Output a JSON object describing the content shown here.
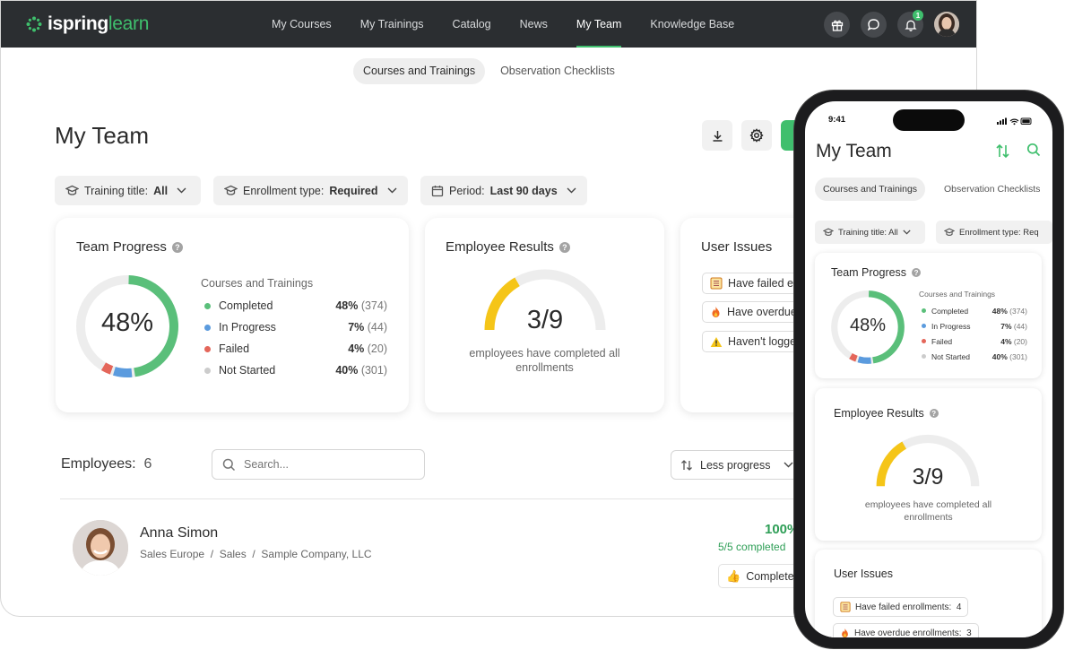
{
  "app": {
    "logo_brand": "ispring",
    "logo_suffix": "learn"
  },
  "nav": {
    "items": [
      "My Courses",
      "My Trainings",
      "Catalog",
      "News",
      "My Team",
      "Knowledge Base"
    ],
    "active": "My Team"
  },
  "notifications": {
    "count": "1"
  },
  "subtabs": {
    "items": [
      "Courses and Trainings",
      "Observation Checklists"
    ],
    "active": "Courses and Trainings"
  },
  "page": {
    "title": "My Team"
  },
  "filters": {
    "training": {
      "label": "Training title:",
      "value": "All"
    },
    "enrollment": {
      "label": "Enrollment type:",
      "value": "Required"
    },
    "period": {
      "label": "Period:",
      "value": "Last 90 days"
    }
  },
  "team_progress": {
    "title": "Team Progress",
    "center": "48%",
    "subtitle": "Courses and Trainings",
    "items": [
      {
        "label": "Completed",
        "pct": "48%",
        "count": "(374)",
        "color": "#5abf7a",
        "fraction": 0.48
      },
      {
        "label": "In Progress",
        "pct": "7%",
        "count": "(44)",
        "color": "#5b9bde",
        "fraction": 0.07
      },
      {
        "label": "Failed",
        "pct": "4%",
        "count": "(20)",
        "color": "#e4665a",
        "fraction": 0.04
      },
      {
        "label": "Not Started",
        "pct": "40%",
        "count": "(301)",
        "color": "#cccccc",
        "fraction": 0.4
      }
    ]
  },
  "employee_results": {
    "title": "Employee Results",
    "value": "3/9",
    "caption_line1": "employees have completed all",
    "caption_line2": "enrollments",
    "fraction": 0.3333,
    "color": "#f5c518"
  },
  "user_issues": {
    "title": "User Issues",
    "items": [
      {
        "label": "Have failed enrollments:",
        "count": "4",
        "icon": "checklist-icon"
      },
      {
        "label": "Have overdue enrollments:",
        "count": "3",
        "icon": "fire-icon"
      },
      {
        "label": "Haven't logged in",
        "count": "",
        "icon": "warning-icon"
      }
    ],
    "desktop_visible": [
      "Have failed er",
      "Have overdue",
      "Haven't logged"
    ]
  },
  "employees": {
    "label": "Employees:",
    "count": "6",
    "search_placeholder": "Search...",
    "sort_label": "Less progress",
    "rows": [
      {
        "name": "Anna Simon",
        "dept": "Sales Europe  /  Sales  /  Sample Company, LLC",
        "pct": "100%",
        "completed": "5/5 completed",
        "status": "Completed"
      }
    ]
  },
  "phone": {
    "time": "9:41",
    "title": "My Team",
    "tabs": [
      "Courses and Trainings",
      "Observation Checklists"
    ],
    "filter_training": "Training title: All",
    "filter_enrollment": "Enrollment type: Req",
    "issues": [
      "Have failed enrollments:  4",
      "Have overdue enrollments:  3"
    ]
  },
  "colors": {
    "accent": "#3fbf6d",
    "topbar": "#2b2e31"
  }
}
